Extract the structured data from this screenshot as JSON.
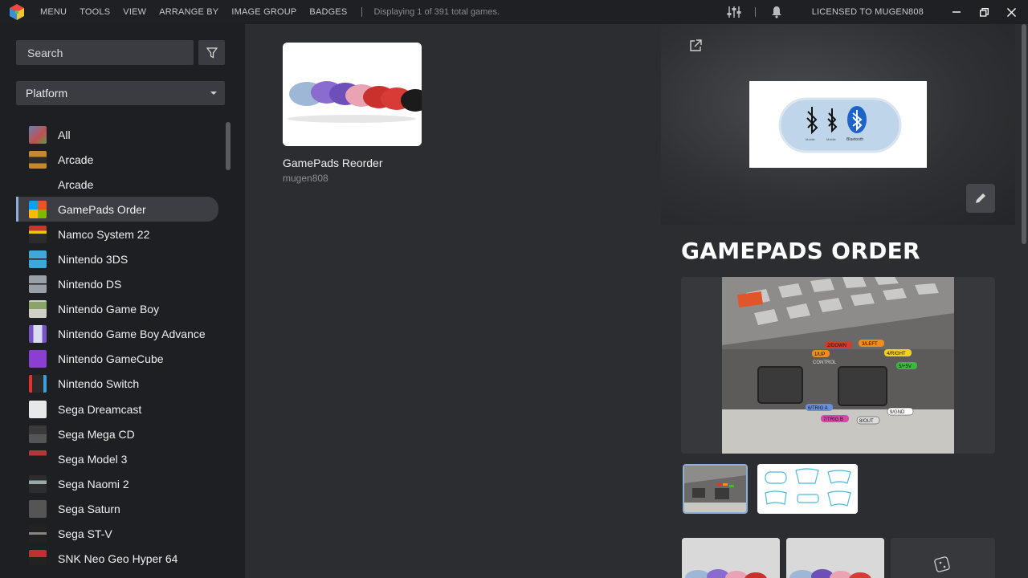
{
  "menu": {
    "items": [
      "MENU",
      "TOOLS",
      "VIEW",
      "ARRANGE BY",
      "IMAGE GROUP",
      "BADGES"
    ],
    "status": "Displaying 1 of 391 total games.",
    "license": "LICENSED TO MUGEN808"
  },
  "sidebar": {
    "search_placeholder": "Search",
    "platform_select": "Platform",
    "items": [
      {
        "label": "All",
        "icon": "all-platforms-icon",
        "color": "#6b7fb0"
      },
      {
        "label": "Arcade",
        "icon": "arcade-cabinet-icon",
        "color": "#c58a2e"
      },
      {
        "label": "Arcade",
        "icon": "",
        "color": ""
      },
      {
        "label": "GamePads Order",
        "icon": "windows-logo-icon",
        "color": "#e04c2d"
      },
      {
        "label": "Namco System 22",
        "icon": "arcade-cabinet-icon",
        "color": "#c0392b"
      },
      {
        "label": "Nintendo 3DS",
        "icon": "handheld-3ds-icon",
        "color": "#3fa8d8"
      },
      {
        "label": "Nintendo DS",
        "icon": "handheld-ds-icon",
        "color": "#9aa0a8"
      },
      {
        "label": "Nintendo Game Boy",
        "icon": "gameboy-icon",
        "color": "#b8b8b0"
      },
      {
        "label": "Nintendo Game Boy Advance",
        "icon": "gba-icon",
        "color": "#7a52c7"
      },
      {
        "label": "Nintendo GameCube",
        "icon": "gamecube-icon",
        "color": "#8a3fd1"
      },
      {
        "label": "Nintendo Switch",
        "icon": "switch-icon",
        "color": "#4a4a4a"
      },
      {
        "label": "Sega Dreamcast",
        "icon": "dreamcast-icon",
        "color": "#e8e8e8"
      },
      {
        "label": "Sega Mega CD",
        "icon": "mega-cd-icon",
        "color": "#3a3a3a"
      },
      {
        "label": "Sega Model 3",
        "icon": "arcade-cabinet-icon",
        "color": "#b03a3a"
      },
      {
        "label": "Sega Naomi 2",
        "icon": "arcade-cabinet-icon",
        "color": "#2d2d2d"
      },
      {
        "label": "Sega Saturn",
        "icon": "saturn-icon",
        "color": "#555"
      },
      {
        "label": "Sega ST-V",
        "icon": "arcade-cabinet-icon",
        "color": "#222"
      },
      {
        "label": "SNK Neo Geo Hyper 64",
        "icon": "arcade-cabinet-icon",
        "color": "#c03030"
      }
    ]
  },
  "games": [
    {
      "title": "GamePads Reorder",
      "developer": "mugen808"
    }
  ],
  "details": {
    "title": "GAMEPADS ORDER",
    "screenshot_labels": [
      "2/DOWN",
      "3/LEFT",
      "1/UP",
      "4/RIGHT",
      "5/+5V",
      "CONTROL",
      "6/TRIG A",
      "7/TRIG B",
      "8/OUT",
      "9/GND"
    ],
    "bluetooth_labels": [
      "Mobile",
      "Mobile",
      "Bluetooth"
    ]
  },
  "colors": {
    "accent": "#8fb0d6",
    "sidebar_bg": "#1e1f22",
    "topbar_bg": "#1f2023",
    "main_bg": "#2b2d31"
  }
}
